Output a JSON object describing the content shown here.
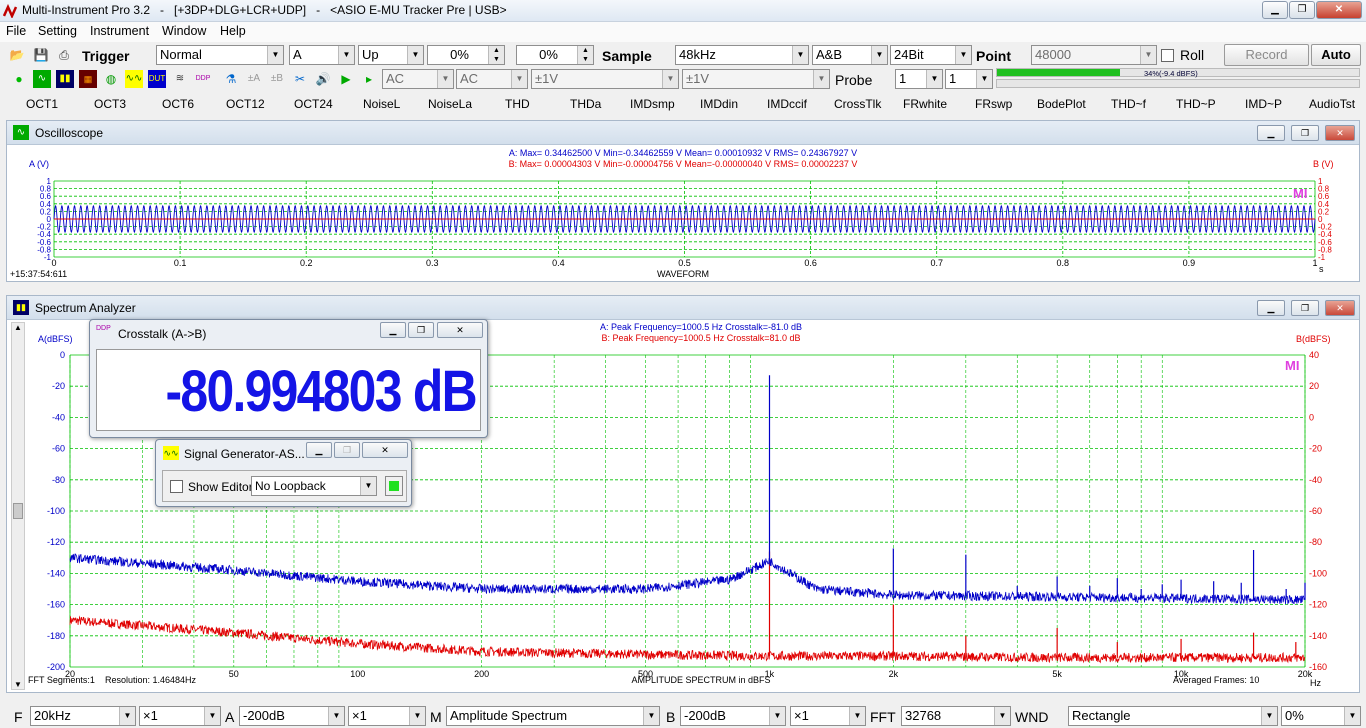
{
  "window": {
    "title": "Multi-Instrument Pro 3.2   -   [+3DP+DLG+LCR+UDP]   -   <ASIO E-MU Tracker Pre | USB>"
  },
  "menu": [
    "File",
    "Setting",
    "Instrument",
    "Window",
    "Help"
  ],
  "toolbar1": {
    "trigger_label": "Trigger",
    "trigger_mode": "Normal",
    "channel": "A",
    "edge": "Up",
    "level": "0%",
    "delay": "0%",
    "sample_label": "Sample",
    "sample_rate": "48kHz",
    "channels": "A&B",
    "bits": "24Bit",
    "point_label": "Point",
    "points": "48000",
    "roll_label": "Roll",
    "record_label": "Record",
    "auto_label": "Auto"
  },
  "toolbar2": {
    "coupling_a": "AC",
    "coupling_b": "AC",
    "range_a": "±1V",
    "range_b": "±1V",
    "probe_label": "Probe",
    "probe_a": "1",
    "probe_b": "1",
    "level_text": "34%(-9.4 dBFS)",
    "level_fraction": 0.34
  },
  "toolbar3": [
    "OCT1",
    "OCT3",
    "OCT6",
    "OCT12",
    "OCT24",
    "NoiseL",
    "NoiseLa",
    "THD",
    "THDa",
    "IMDsmp",
    "IMDdin",
    "IMDccif",
    "CrossTlk",
    "FRwhite",
    "FRswp",
    "BodePlot",
    "THD~f",
    "THD~P",
    "IMD~P",
    "AudioTst"
  ],
  "oscilloscope": {
    "title": "Oscilloscope",
    "stats_a": "A: Max= 0.34462500 V  Min=-0.34462559 V  Mean= 0.00010932 V  RMS= 0.24367927 V",
    "stats_b": "B: Max= 0.00004303 V  Min=-0.00004756 V  Mean=-0.00000040 V  RMS= 0.00002237 V",
    "ylabel_a": "A (V)",
    "ylabel_b": "B (V)",
    "xlabel": "WAVEFORM",
    "timestamp": "+15:37:54:611",
    "x_unit": "s",
    "watermark": "MI",
    "yticks": [
      "1",
      "0.8",
      "0.6",
      "0.4",
      "0.2",
      "0",
      "-0.2",
      "-0.4",
      "-0.6",
      "-0.8",
      "-1"
    ],
    "xticks": [
      "0",
      "0.1",
      "0.2",
      "0.3",
      "0.4",
      "0.5",
      "0.6",
      "0.7",
      "0.8",
      "0.9",
      "1"
    ],
    "colors": {
      "a": "#0000c8",
      "b": "#e00000",
      "grid": "#00c000"
    }
  },
  "spectrum": {
    "title": "Spectrum Analyzer",
    "stats_a": "A: Peak Frequency=1000.5 Hz  Crosstalk=-81.0 dB",
    "stats_b": "B: Peak Frequency=1000.5 Hz  Crosstalk=81.0 dB",
    "ylabel_a": "A(dBFS)",
    "ylabel_b": "B(dBFS)",
    "xlabel": "AMPLITUDE SPECTRUM in dBFS",
    "fft_segments": "FFT Segments:1",
    "resolution": "Resolution: 1.46484Hz",
    "averaged": "Averaged Frames: 10",
    "x_unit": "Hz",
    "watermark": "MI",
    "yticks_left": [
      "0",
      "-20",
      "-40",
      "-60",
      "-80",
      "-100",
      "-120",
      "-140",
      "-160",
      "-180",
      "-200"
    ],
    "yticks_right": [
      "40",
      "20",
      "0",
      "-20",
      "-40",
      "-60",
      "-80",
      "-100",
      "-120",
      "-140",
      "-160"
    ],
    "xticks": [
      {
        "f": 20,
        "label": "20"
      },
      {
        "f": 50,
        "label": "50"
      },
      {
        "f": 100,
        "label": "100"
      },
      {
        "f": 200,
        "label": "200"
      },
      {
        "f": 500,
        "label": "500"
      },
      {
        "f": 1000,
        "label": "1k"
      },
      {
        "f": 2000,
        "label": "2k"
      },
      {
        "f": 5000,
        "label": "5k"
      },
      {
        "f": 10000,
        "label": "10k"
      },
      {
        "f": 20000,
        "label": "20k"
      }
    ]
  },
  "crosstalk_dialog": {
    "title": "Crosstalk (A->B)",
    "value": "-80.994803 dB"
  },
  "siggen_dialog": {
    "title": "Signal Generator-AS...",
    "show_editor": "Show Editor",
    "loopback": "No Loopback"
  },
  "bottombar": {
    "f_label": "F",
    "f_range": "20kHz",
    "f_zoom": "×1",
    "a_label": "A",
    "a_range": "-200dB",
    "a_zoom": "×1",
    "m_label": "M",
    "mode": "Amplitude Spectrum",
    "b_label": "B",
    "b_range": "-200dB",
    "b_zoom": "×1",
    "fft_label": "FFT",
    "fft_size": "32768",
    "wnd_label": "WND",
    "window": "Rectangle",
    "overlap": "0%"
  },
  "chart_data": [
    {
      "type": "line",
      "xlabel": "WAVEFORM",
      "ylabel": "A (V)",
      "xlim": [
        0,
        1
      ],
      "ylim": [
        -1,
        1
      ],
      "series": [
        {
          "name": "A",
          "amplitude": 0.3446,
          "rms": 0.2437,
          "cycles": 200
        },
        {
          "name": "B",
          "amplitude": 4e-05
        }
      ]
    },
    {
      "type": "line",
      "xlabel": "AMPLITUDE SPECTRUM in dBFS",
      "ylabel": "A(dBFS)",
      "xscale": "log",
      "xlim": [
        20,
        20000
      ],
      "ylim": [
        -200,
        0
      ],
      "series": [
        {
          "name": "A",
          "noise_floor": [
            [
              20,
              -130
            ],
            [
              50,
              -138
            ],
            [
              100,
              -145
            ],
            [
              200,
              -150
            ],
            [
              500,
              -150
            ],
            [
              800,
              -144
            ],
            [
              1000,
              -132
            ],
            [
              1300,
              -150
            ],
            [
              2000,
              -154
            ],
            [
              5000,
              -155
            ],
            [
              10000,
              -156
            ],
            [
              20000,
              -157
            ]
          ],
          "peaks": [
            [
              1000.5,
              -13
            ],
            [
              2000,
              -124
            ],
            [
              3000,
              -128
            ],
            [
              4000,
              -148
            ],
            [
              5000,
              -142
            ],
            [
              6000,
              -148
            ],
            [
              7000,
              -143
            ],
            [
              8000,
              -150
            ],
            [
              9000,
              -147
            ],
            [
              10000,
              -144
            ],
            [
              12000,
              -145
            ],
            [
              14000,
              -146
            ],
            [
              15000,
              -125
            ],
            [
              18000,
              -150
            ],
            [
              20000,
              -146
            ]
          ]
        },
        {
          "name": "B",
          "noise_floor": [
            [
              20,
              -170
            ],
            [
              50,
              -178
            ],
            [
              100,
              -185
            ],
            [
              200,
              -190
            ],
            [
              500,
              -192
            ],
            [
              1000,
              -193
            ],
            [
              2000,
              -193
            ],
            [
              5000,
              -194
            ],
            [
              10000,
              -194
            ],
            [
              20000,
              -194
            ]
          ],
          "peaks": [
            [
              1000.5,
              -126
            ],
            [
              2000,
              -160
            ],
            [
              3000,
              -180
            ],
            [
              5000,
              -175
            ],
            [
              7000,
              -184
            ],
            [
              10000,
              -182
            ],
            [
              15000,
              -178
            ],
            [
              19000,
              -184
            ]
          ]
        }
      ]
    }
  ]
}
